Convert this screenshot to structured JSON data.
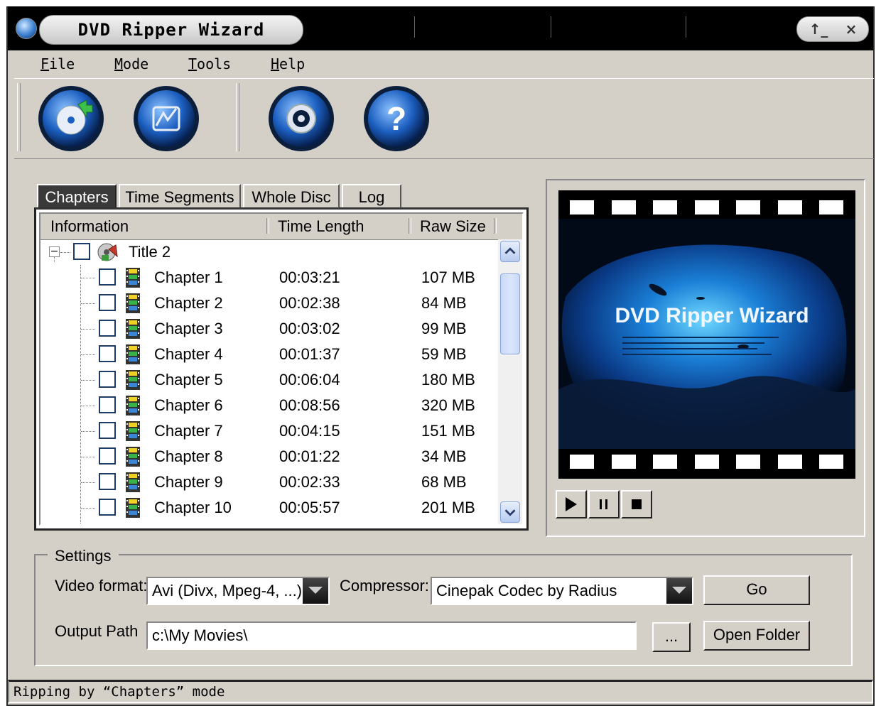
{
  "window": {
    "title": "DVD Ripper Wizard",
    "controls": {
      "minimize": "↑_",
      "close": "×"
    }
  },
  "menu": [
    {
      "mnemonic": "F",
      "rest": "ile"
    },
    {
      "mnemonic": "M",
      "rest": "ode"
    },
    {
      "mnemonic": "T",
      "rest": "ools"
    },
    {
      "mnemonic": "H",
      "rest": "elp"
    }
  ],
  "toolbar": {
    "icons": [
      "rip-disc-icon",
      "wizard-icon",
      "settings-icon",
      "help-icon"
    ],
    "help_glyph": "?"
  },
  "tabs": [
    {
      "label": "Chapters",
      "active": true
    },
    {
      "label": "Time Segments",
      "active": false
    },
    {
      "label": "Whole Disc",
      "active": false
    },
    {
      "label": "Log",
      "active": false
    }
  ],
  "list": {
    "columns": [
      "Information",
      "Time Length",
      "Raw Size"
    ],
    "title_node": {
      "expander": "−",
      "label": "Title 2"
    },
    "chapters": [
      {
        "name": "Chapter 1",
        "time": "00:03:21",
        "size": "107 MB"
      },
      {
        "name": "Chapter 2",
        "time": "00:02:38",
        "size": "84 MB"
      },
      {
        "name": "Chapter 3",
        "time": "00:03:02",
        "size": "99 MB"
      },
      {
        "name": "Chapter 4",
        "time": "00:01:37",
        "size": "59 MB"
      },
      {
        "name": "Chapter 5",
        "time": "00:06:04",
        "size": "180 MB"
      },
      {
        "name": "Chapter 6",
        "time": "00:08:56",
        "size": "320 MB"
      },
      {
        "name": "Chapter 7",
        "time": "00:04:15",
        "size": "151 MB"
      },
      {
        "name": "Chapter 8",
        "time": "00:01:22",
        "size": "34 MB"
      },
      {
        "name": "Chapter 9",
        "time": "00:02:33",
        "size": "68 MB"
      },
      {
        "name": "Chapter 10",
        "time": "00:05:57",
        "size": "201 MB"
      }
    ]
  },
  "preview": {
    "overlay_title": "DVD Ripper Wizard",
    "controls": [
      "play-icon",
      "pause-icon",
      "stop-icon"
    ]
  },
  "settings": {
    "group_label": "Settings",
    "video_format_label": "Video format:",
    "video_format_value": "Avi (Divx, Mpeg-4, ...)",
    "compressor_label": "Compressor:",
    "compressor_value": "Cinepak Codec by Radius",
    "go_label": "Go",
    "output_path_label": "Output Path",
    "output_path_value": "c:\\My Movies\\",
    "browse_label": "...",
    "open_folder_label": "Open Folder"
  },
  "status": {
    "text": "Ripping by “Chapters” mode"
  },
  "colors": {
    "accent": "#1f5fbf",
    "frame": "#000000",
    "face": "#d4d0c8"
  }
}
